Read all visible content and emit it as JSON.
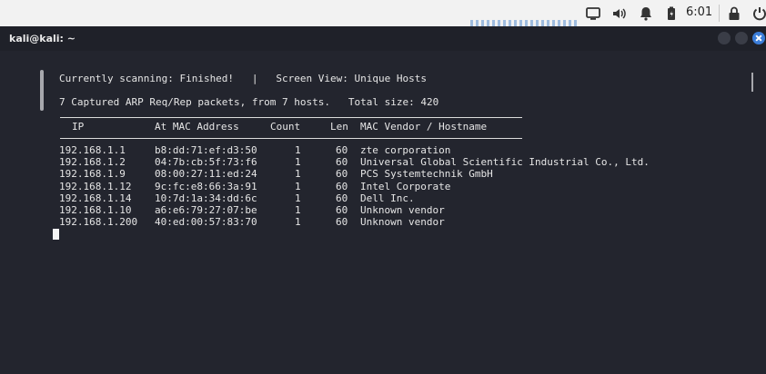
{
  "system_bar": {
    "clock": "6:01"
  },
  "window": {
    "title": "kali@kali: ~"
  },
  "terminal": {
    "status_line": "Currently scanning: Finished!   |   Screen View: Unique Hosts",
    "summary_line": "7 Captured ARP Req/Rep packets, from 7 hosts.   Total size: 420",
    "table": {
      "headers": [
        "IP",
        "At MAC Address",
        "Count",
        "Len",
        "MAC Vendor / Hostname"
      ],
      "rows": [
        {
          "ip": "192.168.1.1",
          "mac": "b8:dd:71:ef:d3:50",
          "count": "1",
          "len": "60",
          "vendor": "zte corporation"
        },
        {
          "ip": "192.168.1.2",
          "mac": "04:7b:cb:5f:73:f6",
          "count": "1",
          "len": "60",
          "vendor": "Universal Global Scientific Industrial Co., Ltd."
        },
        {
          "ip": "192.168.1.9",
          "mac": "08:00:27:11:ed:24",
          "count": "1",
          "len": "60",
          "vendor": "PCS Systemtechnik GmbH"
        },
        {
          "ip": "192.168.1.12",
          "mac": "9c:fc:e8:66:3a:91",
          "count": "1",
          "len": "60",
          "vendor": "Intel Corporate"
        },
        {
          "ip": "192.168.1.14",
          "mac": "10:7d:1a:34:dd:6c",
          "count": "1",
          "len": "60",
          "vendor": "Dell Inc."
        },
        {
          "ip": "192.168.1.10",
          "mac": "a6:e6:79:27:07:be",
          "count": "1",
          "len": "60",
          "vendor": "Unknown vendor"
        },
        {
          "ip": "192.168.1.200",
          "mac": "40:ed:00:57:83:70",
          "count": "1",
          "len": "60",
          "vendor": "Unknown vendor"
        }
      ]
    }
  },
  "icons": [
    "screen-icon",
    "volume-icon",
    "bell-icon",
    "battery-icon",
    "lock-icon",
    "power-icon",
    "minimize-icon",
    "maximize-icon",
    "close-icon"
  ],
  "colors": {
    "terminal_bg": "#23252e",
    "text": "#e6e6e6",
    "top_panel": "#f2f2f2",
    "close_button": "#3b7dd8"
  }
}
